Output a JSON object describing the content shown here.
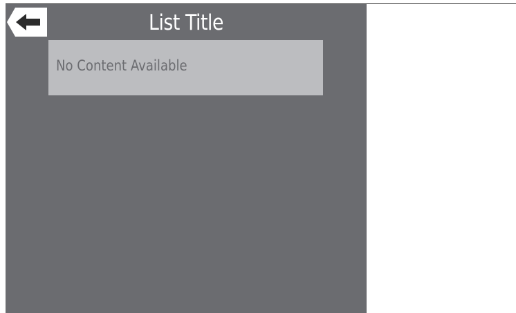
{
  "header": {
    "title": "List Title",
    "back_icon": "left-arrow-icon"
  },
  "list": {
    "empty_message": "No Content Available"
  },
  "colors": {
    "panel_background": "#6b6c70",
    "empty_box_background": "#bcbdc0",
    "title_text": "#ffffff",
    "empty_text": "#6b6c70",
    "back_button_background": "#ffffff",
    "back_arrow": "#2b2b2b"
  }
}
